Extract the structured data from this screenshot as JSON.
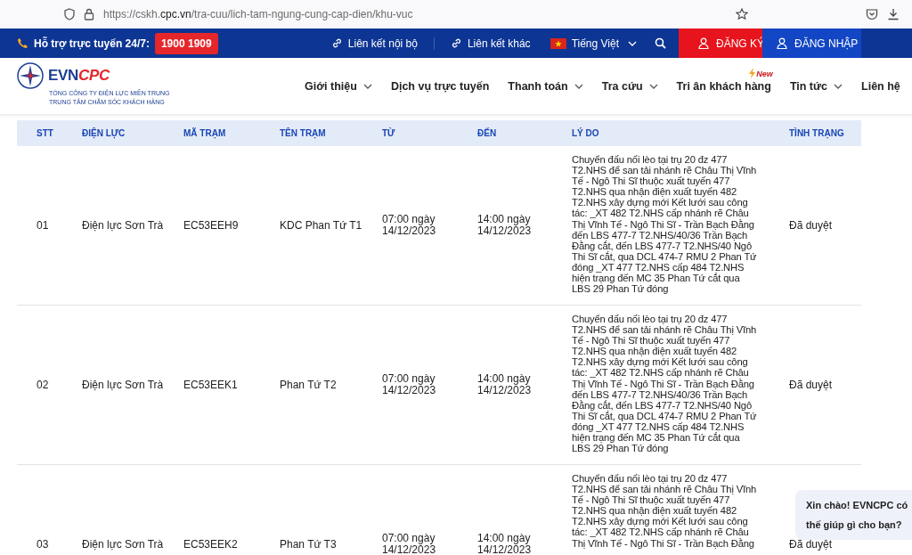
{
  "browser": {
    "url_prefix": "https://cskh.",
    "url_domain": "cpc.vn",
    "url_path": "/tra-cuu/lich-tam-ngung-cung-cap-dien/khu-vuc"
  },
  "top_bar": {
    "support_label": "Hỗ trợ trực tuyến 24/7:",
    "hotline": "1900 1909",
    "links": [
      "Liên kết nội bộ",
      "Liên kết khác"
    ],
    "language": "Tiếng Việt",
    "register": "ĐĂNG KÝ",
    "login": "ĐĂNG NHẬP"
  },
  "brand": {
    "logo_evn": "EVN",
    "logo_cpc": "CPC",
    "line_1": "TỔNG CÔNG TY ĐIỆN LỰC MIỀN TRUNG",
    "line_2": "TRUNG TÂM CHĂM SÓC KHÁCH HÀNG"
  },
  "nav": [
    {
      "label": "Giới thiệu",
      "has_menu": true
    },
    {
      "label": "Dịch vụ trực tuyến",
      "has_menu": false
    },
    {
      "label": "Thanh toán",
      "has_menu": true
    },
    {
      "label": "Tra cứu",
      "has_menu": true
    },
    {
      "label": "Tri ân khách hàng",
      "has_menu": false,
      "badge": "New"
    },
    {
      "label": "Tin tức",
      "has_menu": true
    },
    {
      "label": "Liên hệ",
      "has_menu": false
    }
  ],
  "table": {
    "columns": [
      "STT",
      "ĐIỆN LỰC",
      "MÃ TRẠM",
      "TÊN TRẠM",
      "TỪ",
      "ĐẾN",
      "LÝ DO",
      "TÌNH TRẠNG"
    ],
    "rows": [
      {
        "stt": "01",
        "unit": "Điện lực Sơn Trà",
        "station_code": "EC53EEH9",
        "station_name": "KDC Phan Tứ T1",
        "from": "07:00 ngày 14/12/2023",
        "to": "14:00 ngày 14/12/2023",
        "reason": "Chuyển đấu nối lèo tại trụ 20 đz 477 T2.NHS để san tải nhánh rẽ Châu Thị Vĩnh Tế - Ngô Thi Sĩ thuộc xuất tuyến 477 T2.NHS qua nhận điện xuất tuyến 482 T2.NHS xây dựng mới Kết lưới sau công tác: _XT 482 T2.NHS cấp nhánh rẽ Châu Thị Vĩnh Tế - Ngô Thi Sĩ - Trần Bạch Đằng đến LBS 477-7 T2.NHS/40/36 Trần Bạch Đằng cắt, đến LBS 477-7 T2.NHS/40 Ngô Thi Sĩ cắt, qua DCL 474-7 RMU 2 Phan Tứ đóng _XT 477 T2.NHS cấp 484 T2.NHS hiện trạng đến MC 35 Phan Tứ cắt qua LBS 29 Phan Tứ đóng",
        "status": "Đã duyệt"
      },
      {
        "stt": "02",
        "unit": "Điện lực Sơn Trà",
        "station_code": "EC53EEK1",
        "station_name": "Phan Tứ T2",
        "from": "07:00 ngày 14/12/2023",
        "to": "14:00 ngày 14/12/2023",
        "reason": "Chuyển đấu nối lèo tại trụ 20 đz 477 T2.NHS để san tải nhánh rẽ Châu Thị Vĩnh Tế - Ngô Thi Sĩ thuộc xuất tuyến 477 T2.NHS qua nhận điện xuất tuyến 482 T2.NHS xây dựng mới Kết lưới sau công tác: _XT 482 T2.NHS cấp nhánh rẽ Châu Thị Vĩnh Tế - Ngô Thi Sĩ - Trần Bạch Đằng đến LBS 477-7 T2.NHS/40/36 Trần Bạch Đằng cắt, đến LBS 477-7 T2.NHS/40 Ngô Thi Sĩ cắt, qua DCL 474-7 RMU 2 Phan Tứ đóng _XT 477 T2.NHS cấp 484 T2.NHS hiện trạng đến MC 35 Phan Tứ cắt qua LBS 29 Phan Tứ đóng",
        "status": "Đã duyệt"
      },
      {
        "stt": "03",
        "unit": "Điện lực Sơn Trà",
        "station_code": "EC53EEK2",
        "station_name": "Phan Tứ T3",
        "from": "07:00 ngày 14/12/2023",
        "to": "14:00 ngày 14/12/2023",
        "reason": "Chuyển đấu nối lèo tại trụ 20 đz 477 T2.NHS để san tải nhánh rẽ Châu Thị Vĩnh Tế - Ngô Thi Sĩ thuộc xuất tuyến 477 T2.NHS qua nhận điện xuất tuyến 482 T2.NHS xây dựng mới Kết lưới sau công tác: _XT 482 T2.NHS cấp nhánh rẽ Châu Thị Vĩnh Tế - Ngô Thi Sĩ - Trần Bạch Đằng",
        "status": "Đã duyệt"
      }
    ]
  },
  "chat_bubble": "Xin chào! EVNCPC có thế giúp gì cho bạn?"
}
